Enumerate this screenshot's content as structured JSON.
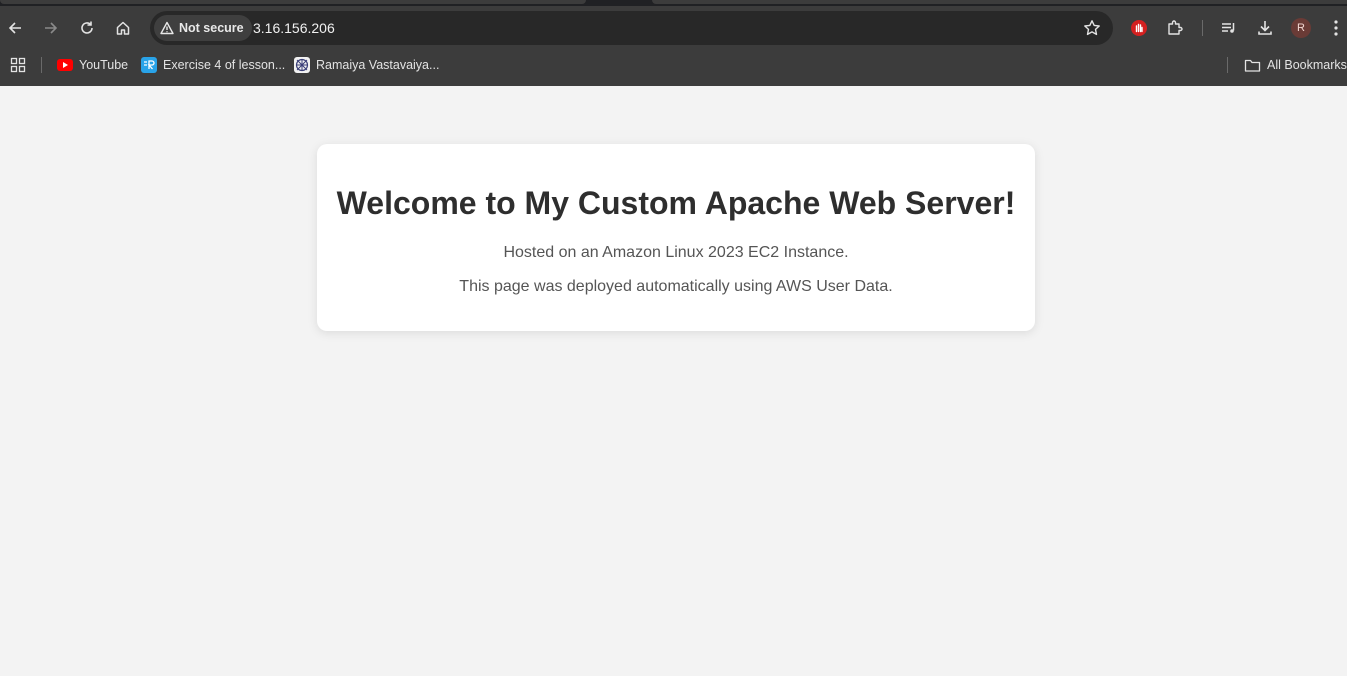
{
  "browser": {
    "security_label": "Not secure",
    "url": "3.16.156.206",
    "avatar_initial": "R",
    "icons": [
      "back-icon",
      "forward-icon",
      "reload-icon",
      "home-icon",
      "warning-icon",
      "star-icon",
      "extension-red-icon",
      "puzzle-icon",
      "media-icon",
      "download-icon",
      "menu-icon"
    ]
  },
  "bookmarks": {
    "items": [
      {
        "label": "YouTube"
      },
      {
        "label": "Exercise 4 of lesson..."
      },
      {
        "label": "Ramaiya Vastavaiya..."
      }
    ],
    "all_label": "All Bookmarks"
  },
  "content": {
    "heading": "Welcome to My Custom Apache Web Server!",
    "line1": "Hosted on an Amazon Linux 2023 EC2 Instance.",
    "line2": "This page was deployed automatically using AWS User Data."
  }
}
